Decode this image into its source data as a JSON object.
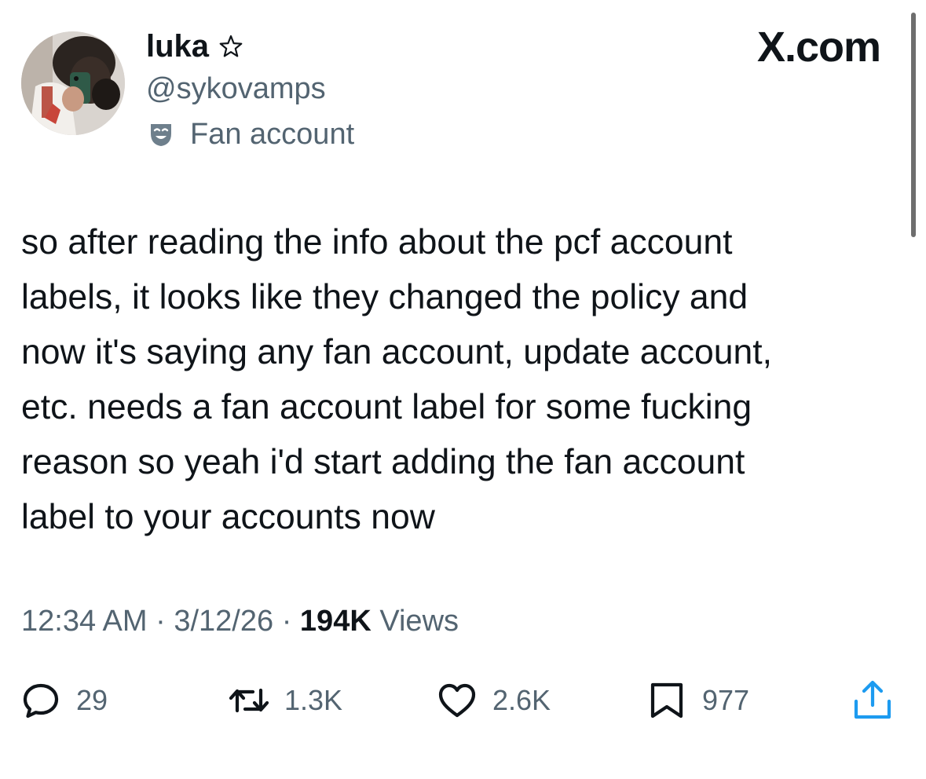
{
  "author": {
    "display_name": "luka",
    "handle": "@sykovamps",
    "account_label": "Fan account"
  },
  "brand": "X.com",
  "tweet": {
    "text": "so after reading the info about the pcf account\nlabels, it looks like they changed the policy and\nnow it's saying any fan account, update account,\netc. needs a fan account label for some fucking\nreason so yeah i'd start adding the fan account\nlabel to your accounts now",
    "time": "12:34 AM",
    "date": "3/12/26",
    "separator": "·",
    "views_count": "194K",
    "views_label": "Views"
  },
  "actions": {
    "replies": "29",
    "reposts": "1.3K",
    "likes": "2.6K",
    "bookmarks": "977"
  },
  "colors": {
    "text": "#0f1419",
    "secondary": "#536471",
    "background": "#ffffff"
  }
}
